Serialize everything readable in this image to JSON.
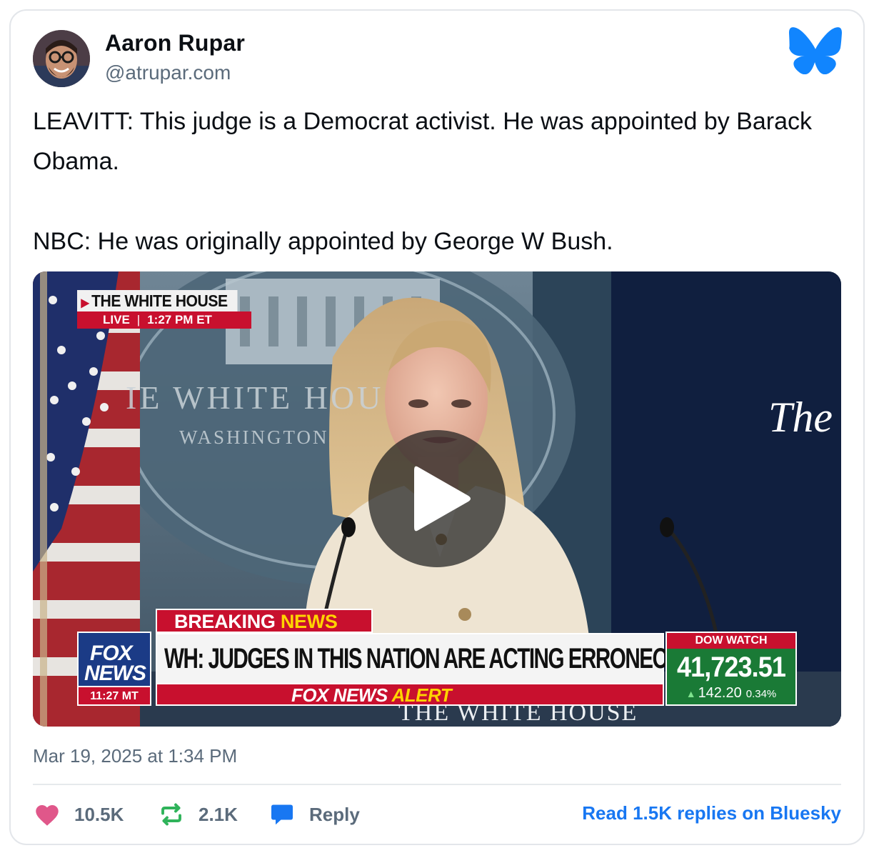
{
  "author": {
    "name": "Aaron Rupar",
    "handle": "@atrupar.com"
  },
  "post": {
    "text": "LEAVITT: This judge is a Democrat activist. He was appointed by Barack Obama.\n\nNBC: He was originally appointed by George W Bush.",
    "timestamp": "Mar 19, 2025 at 1:34 PM"
  },
  "video": {
    "location_tag": "THE WHITE HOUSE",
    "live_label": "LIVE",
    "live_time": "1:27 PM ET",
    "wall_text_line1": "IE WHITE HOU",
    "wall_text_line2": "WASHINGTON",
    "backdrop_text": "The",
    "breaking_prefix": "BREAKING",
    "breaking_suffix": "NEWS",
    "network_line1": "FOX",
    "network_line2": "NEWS",
    "network_time": "11:27 MT",
    "headline": "WH: JUDGES IN THIS NATION ARE ACTING ERRONEOUSLY",
    "alert_prefix": "FOX NEWS",
    "alert_suffix": "ALERT",
    "podium_text": "THE WHITE HOUSE",
    "dow_title": "DOW WATCH",
    "dow_value": "41,723.51",
    "dow_change": "142.20",
    "dow_pct": "0.34%"
  },
  "stats": {
    "likes": "10.5K",
    "reposts": "2.1K",
    "reply_label": "Reply"
  },
  "read_replies_label": "Read 1.5K replies on Bluesky",
  "colors": {
    "like": "#e0578a",
    "repost": "#2fb35a",
    "reply": "#1877f2",
    "bluesky": "#1185fe",
    "link": "#1877f2"
  },
  "icons": {
    "logo": "bluesky-butterfly-icon",
    "like": "heart-icon",
    "repost": "repost-arrows-icon",
    "reply": "speech-bubble-icon",
    "play": "play-icon"
  }
}
